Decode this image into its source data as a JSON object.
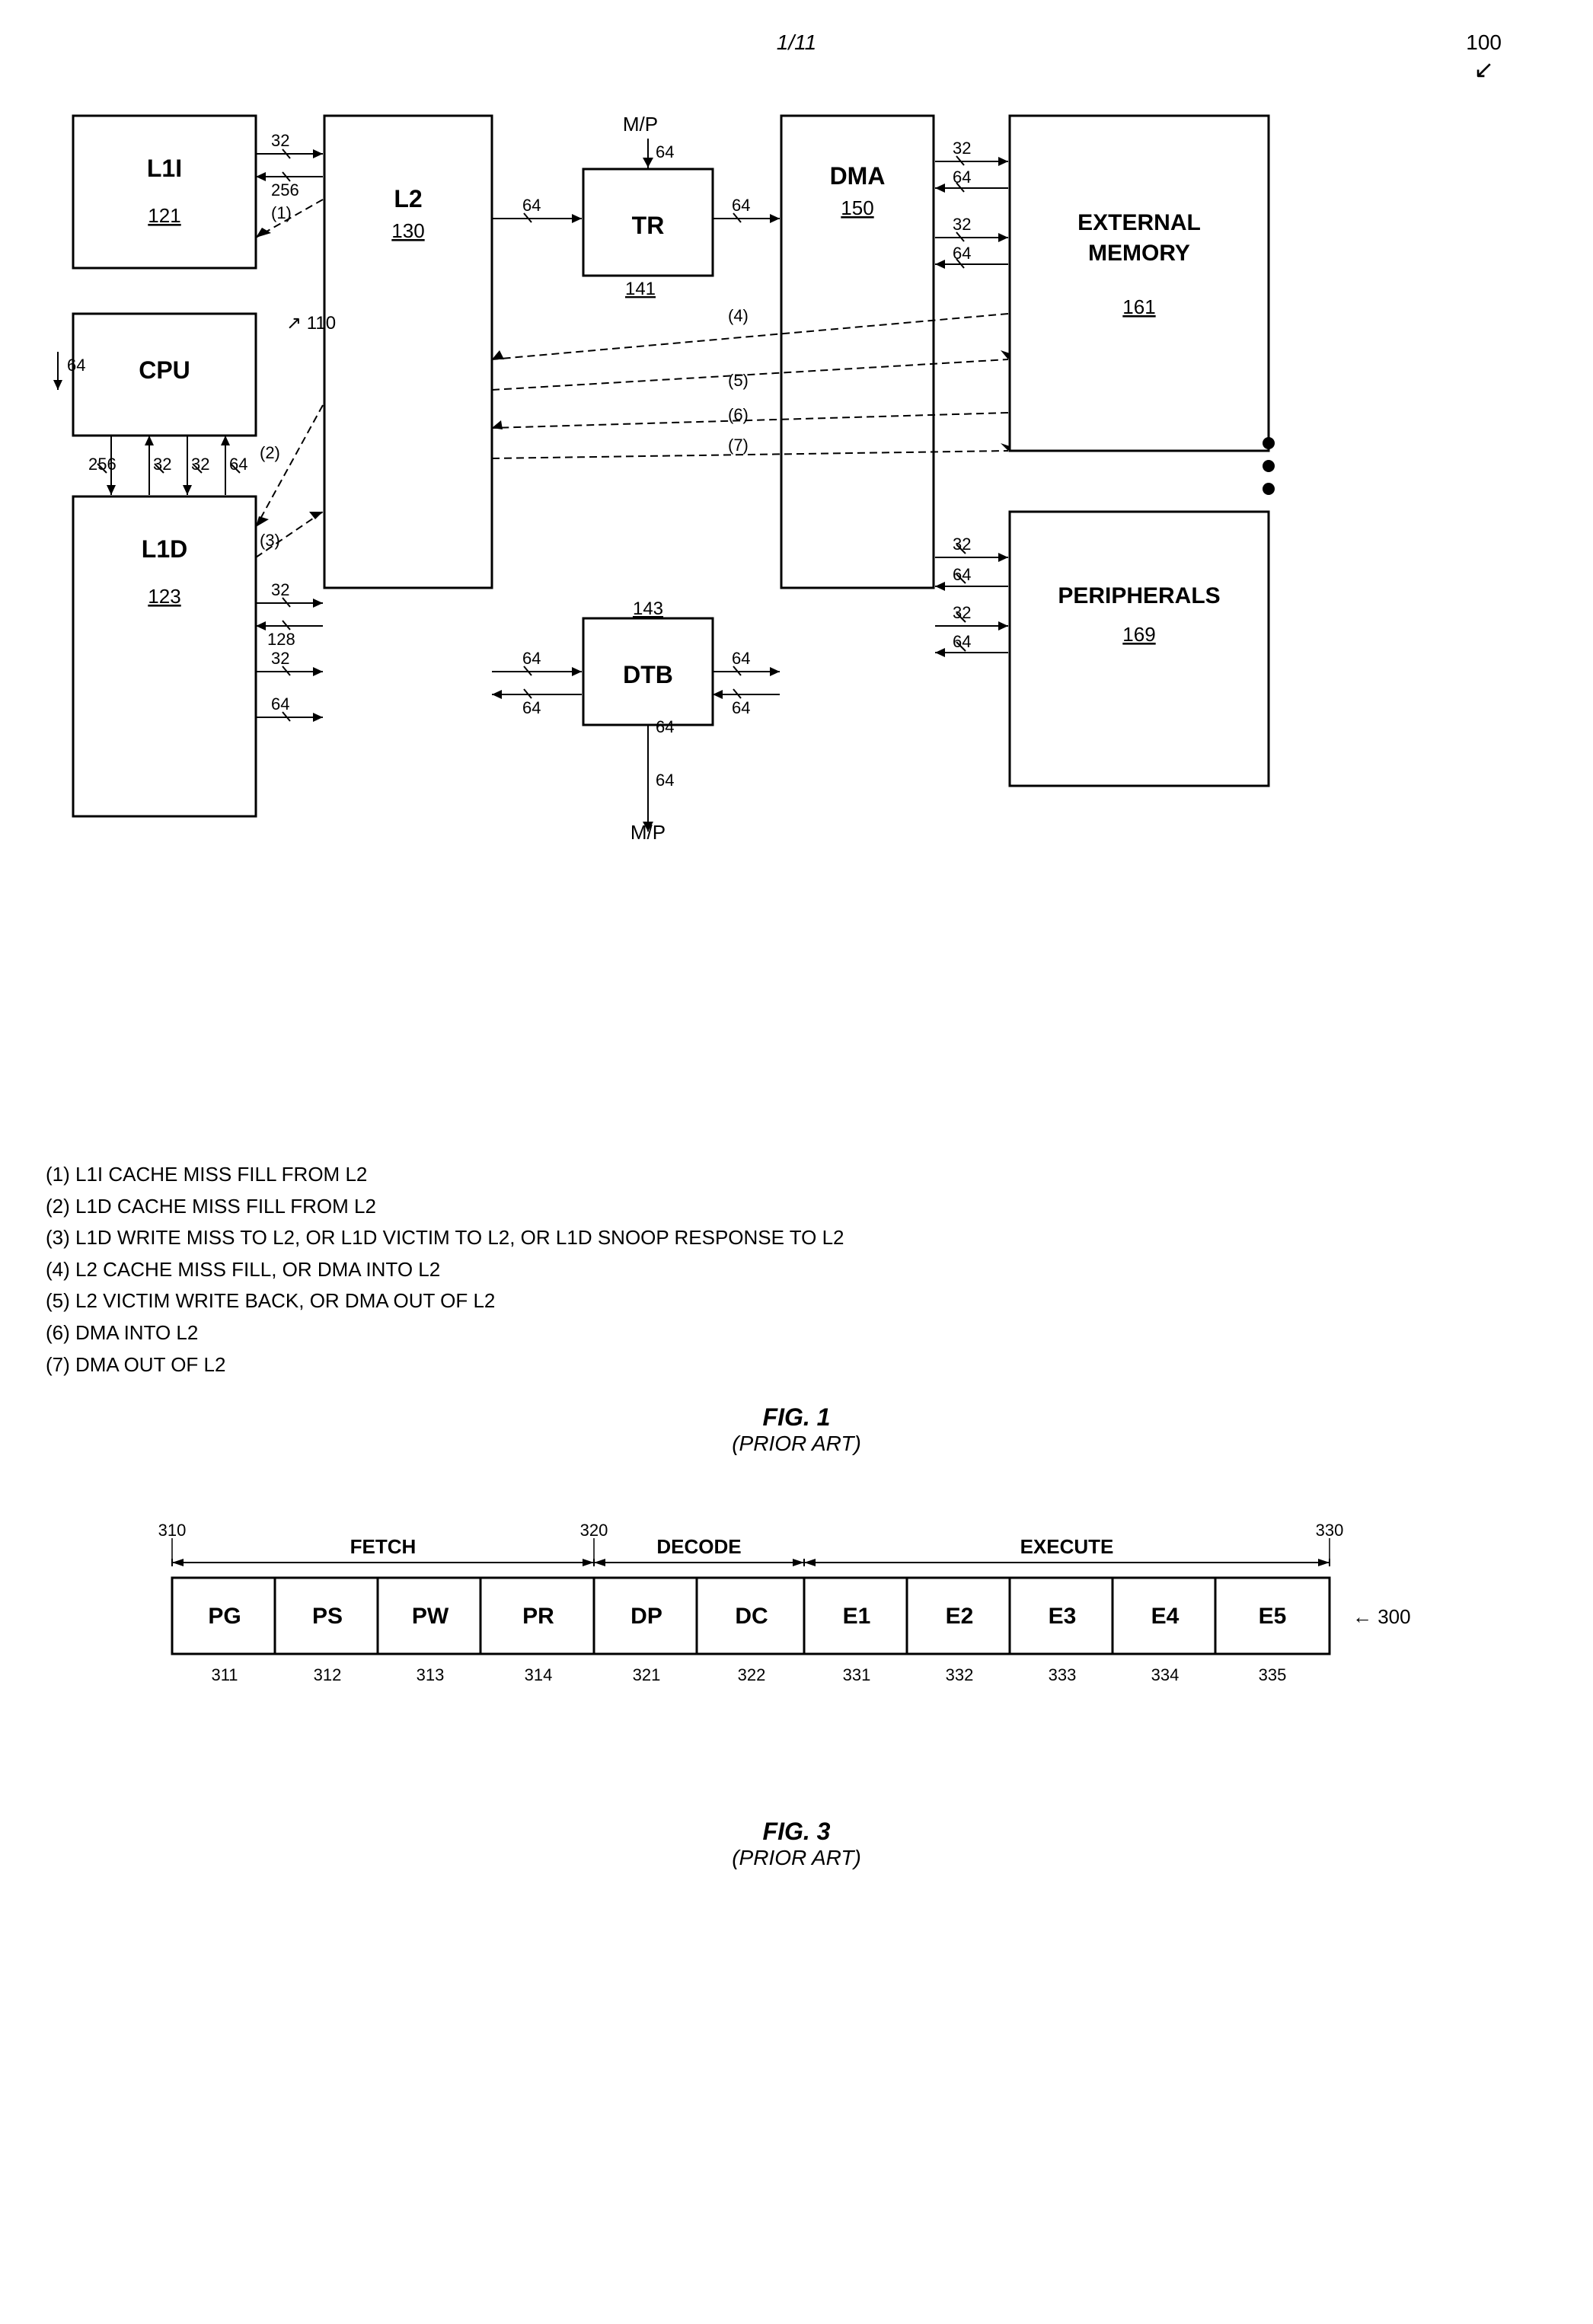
{
  "header": {
    "page_number": "1/11",
    "ref_number": "100"
  },
  "fig1": {
    "title": "FIG. 1",
    "subtitle": "(PRIOR ART)",
    "boxes": [
      {
        "id": "l1i",
        "label": "L1I",
        "number": "121"
      },
      {
        "id": "l2",
        "label": "L2",
        "number": "130"
      },
      {
        "id": "tr",
        "label": "TR",
        "number": "141"
      },
      {
        "id": "dma",
        "label": "DMA",
        "number": "150"
      },
      {
        "id": "ext_mem",
        "label1": "EXTERNAL",
        "label2": "MEMORY",
        "number": "161"
      },
      {
        "id": "cpu",
        "label": "CPU",
        "number": "110"
      },
      {
        "id": "l1d",
        "label": "L1D",
        "number": "123"
      },
      {
        "id": "dtb",
        "label": "DTB",
        "number": "143"
      },
      {
        "id": "periph",
        "label": "PERIPHERALS",
        "number": "169"
      }
    ],
    "mp_labels": [
      "M/P",
      "M/P"
    ],
    "legend": [
      "(1) L1I CACHE MISS FILL FROM L2",
      "(2) L1D CACHE MISS FILL FROM L2",
      "(3) L1D WRITE MISS TO L2, OR L1D VICTIM TO L2, OR L1D SNOOP RESPONSE TO L2",
      "(4) L2 CACHE MISS FILL, OR DMA INTO L2",
      "(5) L2 VICTIM WRITE BACK, OR DMA OUT OF L2",
      "(6) DMA INTO L2",
      "(7) DMA OUT OF L2"
    ]
  },
  "fig3": {
    "title": "FIG. 3",
    "subtitle": "(PRIOR ART)",
    "phases": [
      {
        "id": "fetch",
        "label": "FETCH",
        "number": "310"
      },
      {
        "id": "decode",
        "label": "DECODE",
        "number": "320"
      },
      {
        "id": "execute",
        "label": "EXECUTE",
        "number": "330"
      }
    ],
    "pipeline_number": "300",
    "stages": [
      {
        "label": "PG",
        "number": "311"
      },
      {
        "label": "PS",
        "number": "312"
      },
      {
        "label": "PW",
        "number": "313"
      },
      {
        "label": "PR",
        "number": "314"
      },
      {
        "label": "DP",
        "number": "321"
      },
      {
        "label": "DC",
        "number": "322"
      },
      {
        "label": "E1",
        "number": "331"
      },
      {
        "label": "E2",
        "number": "332"
      },
      {
        "label": "E3",
        "number": "333"
      },
      {
        "label": "E4",
        "number": "334"
      },
      {
        "label": "E5",
        "number": "335"
      }
    ]
  }
}
